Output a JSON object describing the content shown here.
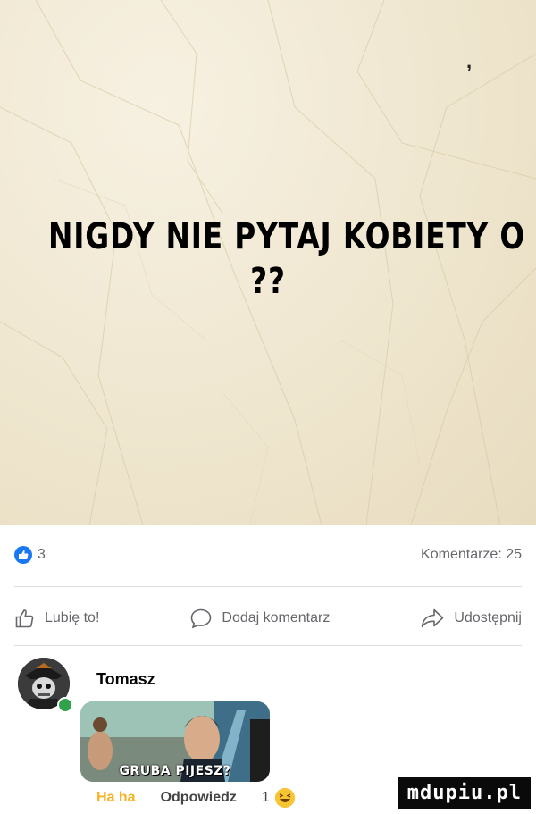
{
  "post": {
    "comma": ",",
    "headline_line1": "NIGDY NIE PYTAJ KOBIETY O ...",
    "headline_line2": "??"
  },
  "stats": {
    "like_count": "3",
    "comments": "Komentarze: 25"
  },
  "actions": {
    "like": "Lubię to!",
    "comment": "Dodaj komentarz",
    "share": "Udostępnij"
  },
  "comment": {
    "author": "Tomasz",
    "gif_caption": "GRUBA PIJESZ?",
    "haha": "Ha ha",
    "reply": "Odpowiedz",
    "reaction_count": "1"
  },
  "watermark": "mdupiu.pl",
  "colors": {
    "accent": "#1877f2",
    "haha": "#f7b125",
    "online": "#31a24c",
    "muted": "#65676b"
  },
  "icons": [
    "like-badge-icon",
    "thumbs-up-icon",
    "comment-bubble-icon",
    "share-arrow-icon",
    "laughing-emoji-icon"
  ]
}
